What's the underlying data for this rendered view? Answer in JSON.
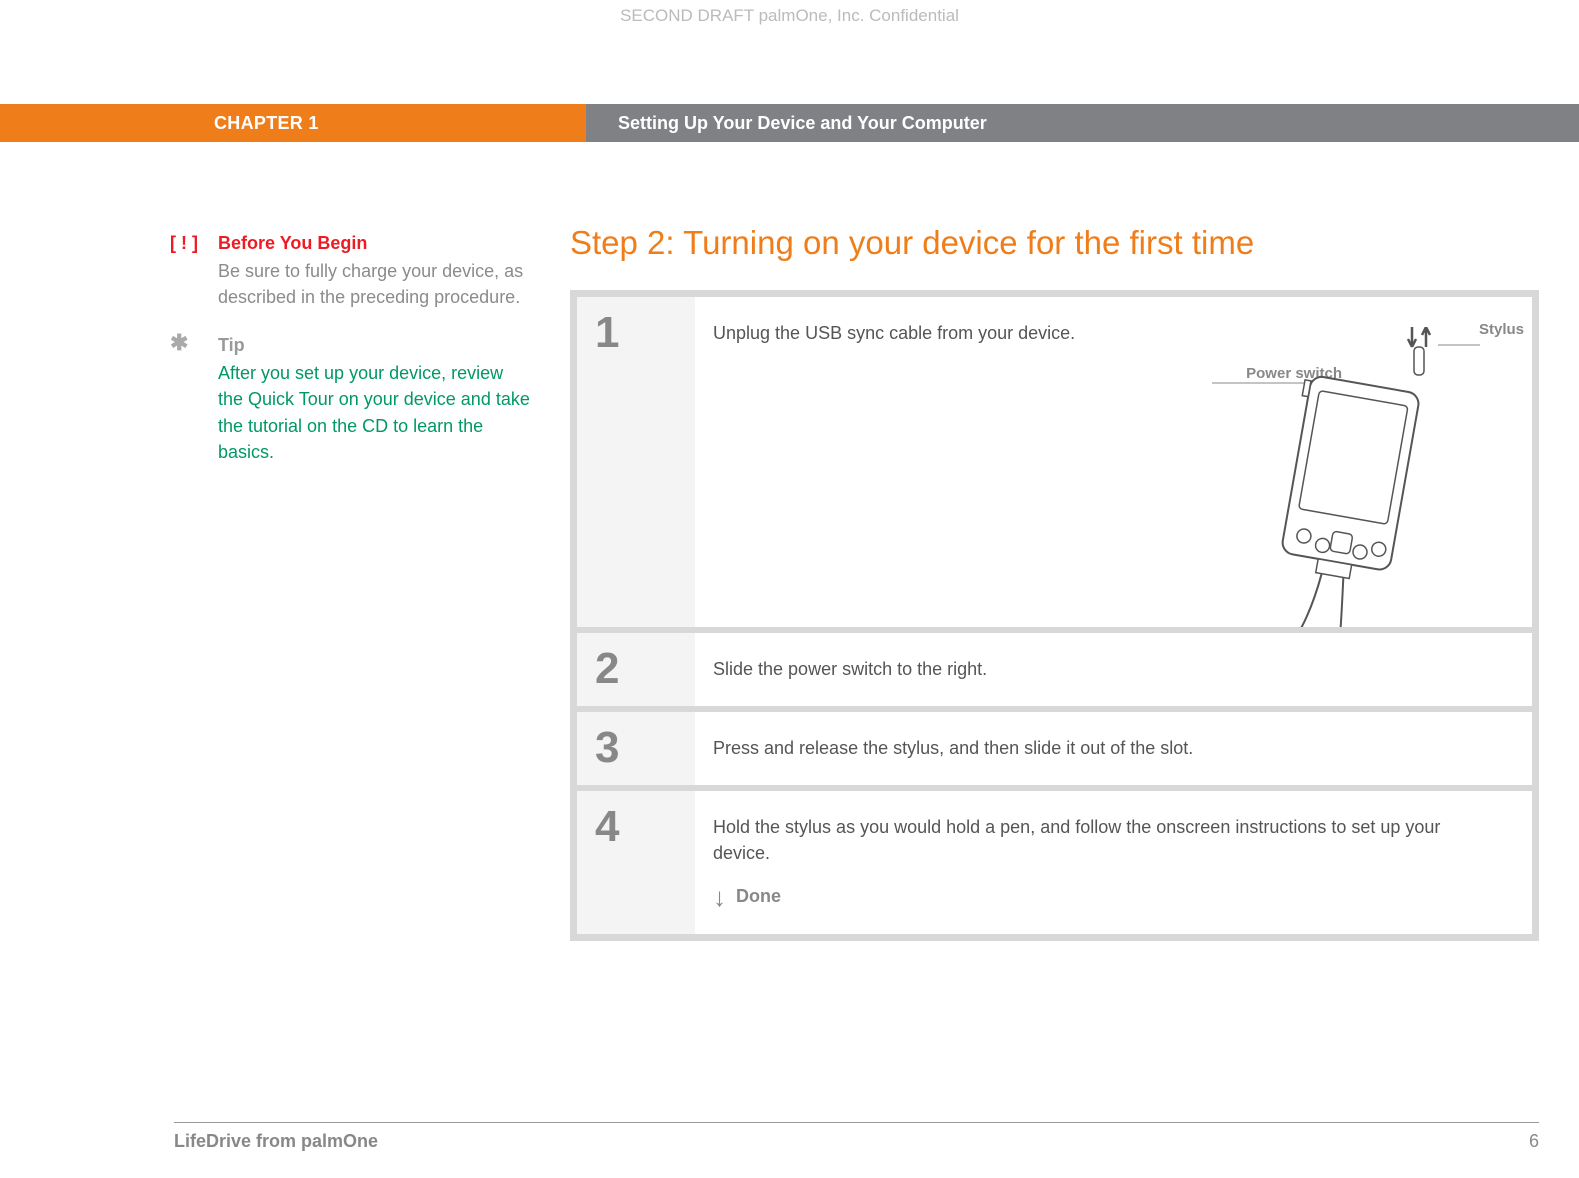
{
  "header_confidential": "SECOND DRAFT palmOne, Inc.  Confidential",
  "chapter_label": "CHAPTER 1",
  "chapter_title": "Setting Up Your Device and Your Computer",
  "sidebar": {
    "before": {
      "icon": "[ ! ]",
      "title": "Before You Begin",
      "body": "Be sure to fully charge your device, as described in the preceding procedure."
    },
    "tip": {
      "icon": "✱",
      "title": "Tip",
      "body": "After you set up your device, review the Quick Tour on your device and take the tutorial on the CD to learn the basics."
    }
  },
  "main": {
    "title": "Step 2: Turning on your device for the first time",
    "steps": [
      {
        "num": "1",
        "text": "Unplug the USB sync cable from your device."
      },
      {
        "num": "2",
        "text": "Slide the power switch to the right."
      },
      {
        "num": "3",
        "text": "Press and release the stylus, and then slide it out of the slot."
      },
      {
        "num": "4",
        "text": "Hold the stylus as you would hold a pen, and follow the onscreen instructions to set up your device."
      }
    ],
    "done_label": "Done",
    "labels": {
      "power": "Power switch",
      "stylus": "Stylus"
    }
  },
  "footer": {
    "product": "LifeDrive from palmOne",
    "page": "6"
  }
}
